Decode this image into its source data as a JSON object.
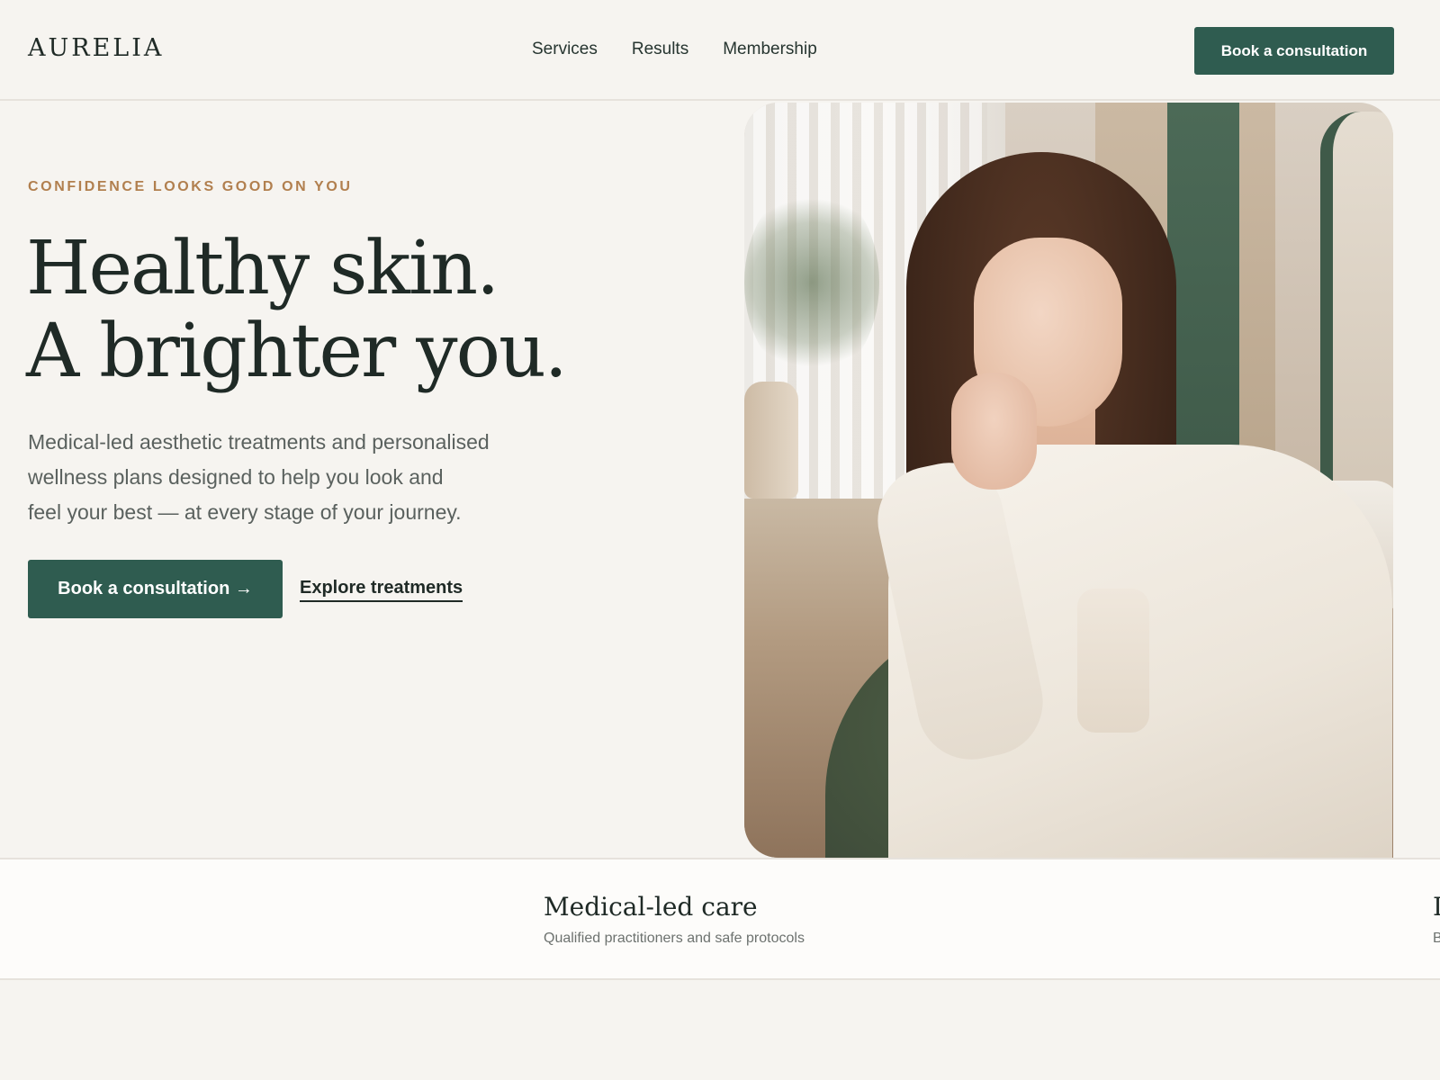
{
  "header": {
    "logo": "AURELIA",
    "nav": [
      {
        "label": "Services"
      },
      {
        "label": "Results"
      },
      {
        "label": "Membership"
      }
    ],
    "cta_label": "Book a consultation"
  },
  "hero": {
    "eyebrow": "CONFIDENCE LOOKS GOOD ON YOU",
    "headline": [
      "Healthy skin.",
      "A brighter you."
    ],
    "lede": [
      "Medical-led aesthetic treatments and personalised",
      "wellness plans designed to help you look and",
      "feel your best — at every stage of your journey."
    ],
    "primary_cta": "Book a consultation →",
    "secondary_cta": "Explore treatments"
  },
  "features": [
    {
      "title": "Medical-led care",
      "desc": "Qualified practitioners and safe protocols"
    },
    {
      "title": "I",
      "desc": "B"
    }
  ],
  "colors": {
    "background": "#f6f4f0",
    "accent_green": "#2f5c50",
    "eyebrow_gold": "#b17f4e",
    "text_dark": "#1f2a26"
  }
}
